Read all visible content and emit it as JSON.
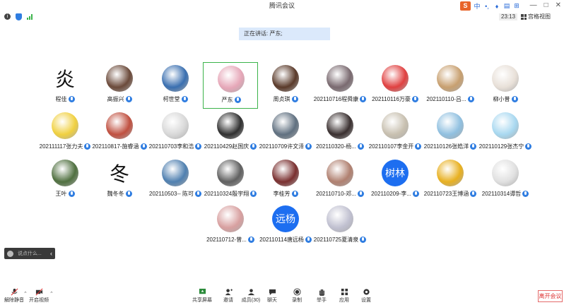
{
  "window": {
    "title": "腾讯会议",
    "controls": [
      "—",
      "□",
      "✕"
    ]
  },
  "ime": {
    "logo": "S",
    "items": [
      "中",
      "•,",
      "🎤",
      "▤",
      "⊞"
    ]
  },
  "status": {
    "timer": "23:13",
    "view_label": "宫格视图"
  },
  "speaking": {
    "label": "正在讲话: 严东;"
  },
  "participants": [
    {
      "name": "程佳",
      "avatar": "glyph",
      "glyph": "炎",
      "color": "#ffffff"
    },
    {
      "name": "高振兴",
      "avatar": "photo",
      "color": "#6b4a3a"
    },
    {
      "name": "柯世堂",
      "avatar": "photo",
      "color": "#3a6fb0"
    },
    {
      "name": "严东",
      "avatar": "photo",
      "color": "#e6a7b8",
      "active": true
    },
    {
      "name": "周贞琪",
      "avatar": "photo",
      "color": "#5a3a2a"
    },
    {
      "name": "202110716程舜康",
      "avatar": "photo",
      "color": "#7a6a70"
    },
    {
      "name": "202110116万豪",
      "avatar": "photo",
      "color": "#e04040"
    },
    {
      "name": "202110110-吕...",
      "avatar": "photo",
      "color": "#c8a070"
    },
    {
      "name": "柳小普",
      "avatar": "photo",
      "color": "#e8e0d8"
    },
    {
      "name": "202111117张力夫",
      "avatar": "photo",
      "color": "#f0d040"
    },
    {
      "name": "20211081​7-施睿涵",
      "avatar": "photo",
      "color": "#c05040"
    },
    {
      "name": "202110703李和浩",
      "avatar": "photo",
      "color": "#d8d8d8"
    },
    {
      "name": "202110429赵国庆",
      "avatar": "photo",
      "color": "#303030"
    },
    {
      "name": "202110709许文泽",
      "avatar": "photo",
      "color": "#607080"
    },
    {
      "name": "202110320-杨...",
      "avatar": "photo",
      "color": "#3a3030"
    },
    {
      "name": "202110107李金开",
      "avatar": "photo",
      "color": "#c8c0b0"
    },
    {
      "name": "202110126张皓洋",
      "avatar": "photo",
      "color": "#90c0e0"
    },
    {
      "name": "202110129张杰宁",
      "avatar": "photo",
      "color": "#a8d8f0"
    },
    {
      "name": "王叶",
      "avatar": "photo",
      "color": "#507040"
    },
    {
      "name": "魏冬冬",
      "avatar": "glyph",
      "glyph": "冬",
      "color": "#ffffff"
    },
    {
      "name": "202110503-- 陈可",
      "avatar": "photo",
      "color": "#5080b0"
    },
    {
      "name": "202110324殷宇翔",
      "avatar": "photo",
      "color": "#606060"
    },
    {
      "name": "李桂芳",
      "avatar": "photo",
      "color": "#7a3030"
    },
    {
      "name": "202110710-邓...",
      "avatar": "photo",
      "color": "#b08070"
    },
    {
      "name": "202110209-李...",
      "avatar": "text",
      "text": "树林",
      "color": "#1d6ef0"
    },
    {
      "name": "202110723王博涵",
      "avatar": "photo",
      "color": "#e8b020"
    },
    {
      "name": "202110314谭哲",
      "avatar": "photo",
      "color": "#e0e0e0"
    },
    {
      "name": "202110712-曾...",
      "avatar": "photo",
      "color": "#d8a0a0"
    },
    {
      "name": "202110114唐远杨",
      "avatar": "text",
      "text": "远杨",
      "color": "#1d6ef0"
    },
    {
      "name": "202110725夏清泉",
      "avatar": "photo",
      "color": "#c0c0d0"
    }
  ],
  "chat": {
    "placeholder": "说点什么..."
  },
  "toolbar": {
    "mute": "解除静音",
    "video": "开启视频",
    "share": "共享屏幕",
    "invite": "邀请",
    "members": "成员(30)",
    "chat": "聊天",
    "record": "录制",
    "raise": "举手",
    "apps": "应用",
    "settings": "设置",
    "leave": "离开会议"
  }
}
